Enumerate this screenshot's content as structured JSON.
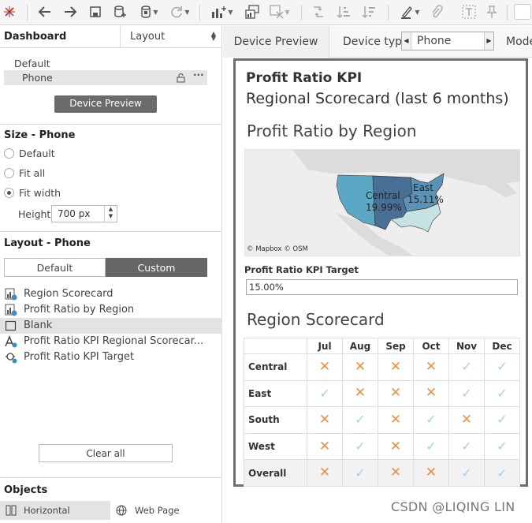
{
  "left_panel": {
    "tabs": {
      "dashboard": "Dashboard",
      "layout": "Layout"
    },
    "device_list": {
      "default": "Default",
      "phone": "Phone"
    },
    "device_preview_button": "Device Preview",
    "size": {
      "title": "Size - Phone",
      "options": [
        "Default",
        "Fit all",
        "Fit width"
      ],
      "selected": "Fit width",
      "height_label": "Height",
      "height_value": "700 px"
    },
    "layout": {
      "title": "Layout - Phone",
      "toggle": [
        "Default",
        "Custom"
      ],
      "selected": "Custom",
      "items": [
        {
          "label": "Region Scorecard",
          "icon": "worksheet-icon"
        },
        {
          "label": "Profit Ratio by Region",
          "icon": "worksheet-icon"
        },
        {
          "label": "Blank",
          "icon": "blank-icon"
        },
        {
          "label": "Profit Ratio KPI Regional Scorecar...",
          "icon": "text-icon"
        },
        {
          "label": "Profit Ratio KPI Target",
          "icon": "parameter-icon"
        }
      ],
      "selected_item": "Blank",
      "clear_all": "Clear all"
    },
    "objects": {
      "title": "Objects",
      "horizontal": "Horizontal",
      "web_page": "Web Page"
    }
  },
  "preview_bar": {
    "device_preview_tab": "Device Preview",
    "device_type_label": "Device type",
    "device_type_value": "Phone",
    "model_label": "Mode"
  },
  "dashboard": {
    "kpi_title": "Profit Ratio KPI",
    "kpi_subtitle": "Regional Scorecard (last 6 months)",
    "map_title": "Profit Ratio by Region",
    "map_labels": [
      {
        "region": "Central",
        "value": "19.99%"
      },
      {
        "region": "East",
        "value": "15.11%"
      }
    ],
    "map_attribution": "© Mapbox © OSM",
    "map_colors": {
      "west": "#5aa8c4",
      "central": "#4a6f96",
      "east": "#5b93b8",
      "south": "#c5e3e2"
    },
    "target_label": "Profit Ratio KPI Target",
    "target_value": "15.00%",
    "scorecard_title": "Region Scorecard",
    "months": [
      "Jul",
      "Aug",
      "Sep",
      "Oct",
      "Nov",
      "Dec"
    ],
    "rows": [
      {
        "region": "Central",
        "marks": [
          "x",
          "x",
          "x",
          "x",
          "check",
          "check"
        ]
      },
      {
        "region": "East",
        "marks": [
          "check",
          "x",
          "x",
          "x",
          "check",
          "check"
        ]
      },
      {
        "region": "South",
        "marks": [
          "x",
          "check",
          "x",
          "check",
          "x",
          "check"
        ]
      },
      {
        "region": "West",
        "marks": [
          "x",
          "check",
          "x",
          "check",
          "check",
          "check"
        ]
      },
      {
        "region": "Overall",
        "marks": [
          "x",
          "check",
          "x",
          "x",
          "check",
          "check"
        ]
      }
    ],
    "mark_colors": {
      "x": "#ef8e3f",
      "check": "#9ed2ee"
    }
  },
  "watermark": "CSDN @LIQING LIN"
}
